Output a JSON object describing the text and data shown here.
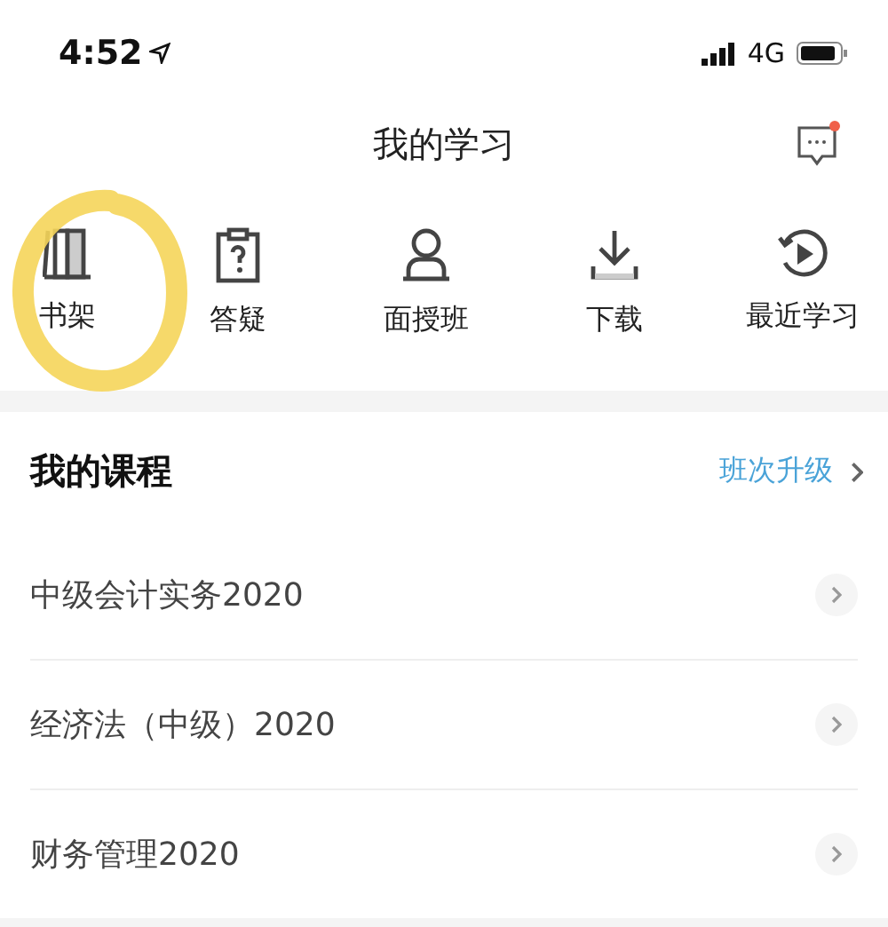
{
  "status_bar": {
    "time": "4:52",
    "network": "4G"
  },
  "header": {
    "title": "我的学习",
    "message_unread": true
  },
  "shortcuts": [
    {
      "kind": "bookshelf",
      "label": "书架",
      "circled": true
    },
    {
      "kind": "question",
      "label": "答疑",
      "circled": false
    },
    {
      "kind": "person",
      "label": "面授班",
      "circled": false
    },
    {
      "kind": "download",
      "label": "下载",
      "circled": false
    },
    {
      "kind": "recent",
      "label": "最近学习",
      "circled": false
    }
  ],
  "courses": {
    "title": "我的课程",
    "link": "班次升级",
    "items": [
      {
        "name": "中级会计实务2020"
      },
      {
        "name": "经济法（中级）2020"
      },
      {
        "name": "财务管理2020"
      }
    ]
  }
}
